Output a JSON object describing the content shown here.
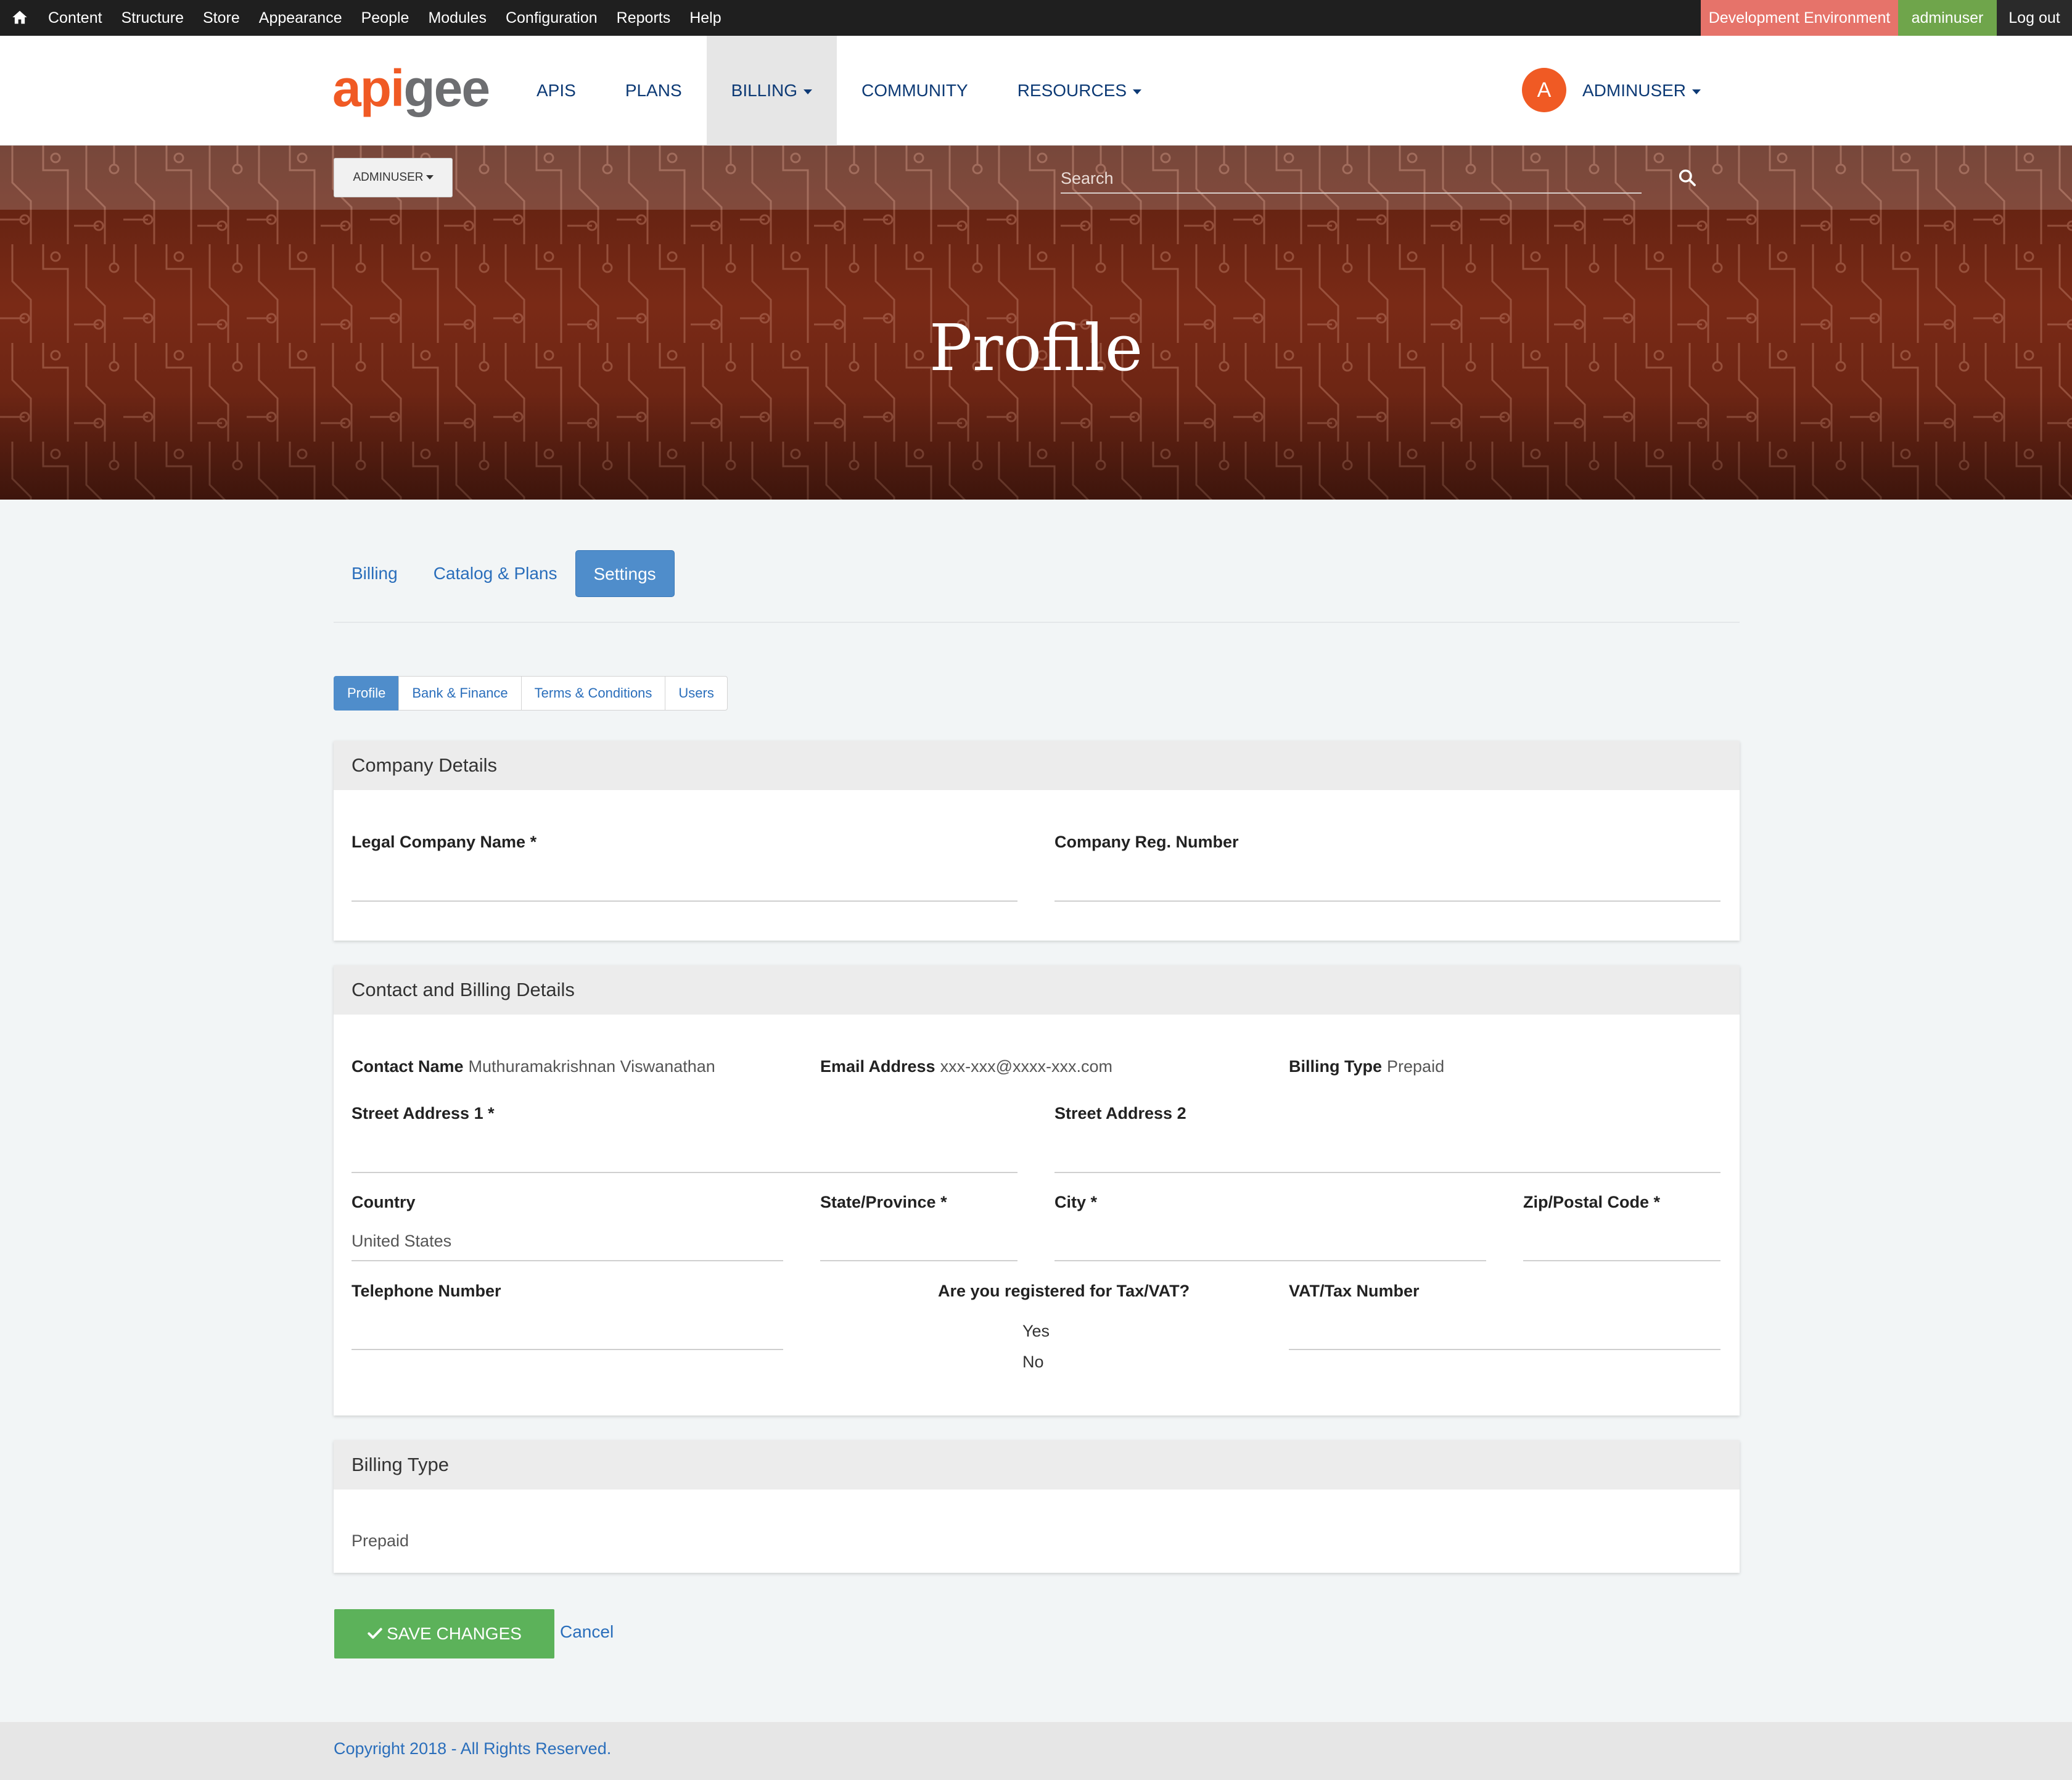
{
  "admin_bar": {
    "menu": [
      "Content",
      "Structure",
      "Store",
      "Appearance",
      "People",
      "Modules",
      "Configuration",
      "Reports",
      "Help"
    ],
    "environment": "Development Environment",
    "username": "adminuser",
    "logout": "Log out"
  },
  "header": {
    "logo_a": "api",
    "logo_b": "gee",
    "nav": [
      "APIS",
      "PLANS",
      "BILLING",
      "COMMUNITY",
      "RESOURCES"
    ],
    "avatar_letter": "A",
    "user_label": "ADMINUSER"
  },
  "hero": {
    "user_dropdown": "ADMINUSER",
    "search_placeholder": "Search",
    "title": "Profile"
  },
  "top_tabs": [
    "Billing",
    "Catalog & Plans",
    "Settings"
  ],
  "sub_tabs": [
    "Profile",
    "Bank & Finance",
    "Terms & Conditions",
    "Users"
  ],
  "company": {
    "heading": "Company Details",
    "legal_name_label": "Legal Company Name *",
    "reg_number_label": "Company Reg. Number"
  },
  "contact": {
    "heading": "Contact and Billing Details",
    "contact_name_label": "Contact Name",
    "contact_name_value": "Muthuramakrishnan Viswanathan",
    "email_label": "Email Address",
    "email_value": "xxx-xxx@xxxx-xxx.com",
    "billing_type_label": "Billing Type",
    "billing_type_value": "Prepaid",
    "street1_label": "Street Address 1 *",
    "street2_label": "Street Address 2",
    "country_label": "Country",
    "country_value": "United States",
    "state_label": "State/Province *",
    "city_label": "City *",
    "zip_label": "Zip/Postal Code *",
    "phone_label": "Telephone Number",
    "tax_question": "Are you registered for Tax/VAT?",
    "tax_yes": "Yes",
    "tax_no": "No",
    "vat_label": "VAT/Tax Number"
  },
  "billing_type": {
    "heading": "Billing Type",
    "value": "Prepaid"
  },
  "actions": {
    "save": "SAVE CHANGES",
    "cancel": "Cancel"
  },
  "footer": {
    "copyright": "Copyright 2018 - All Rights Reserved."
  }
}
